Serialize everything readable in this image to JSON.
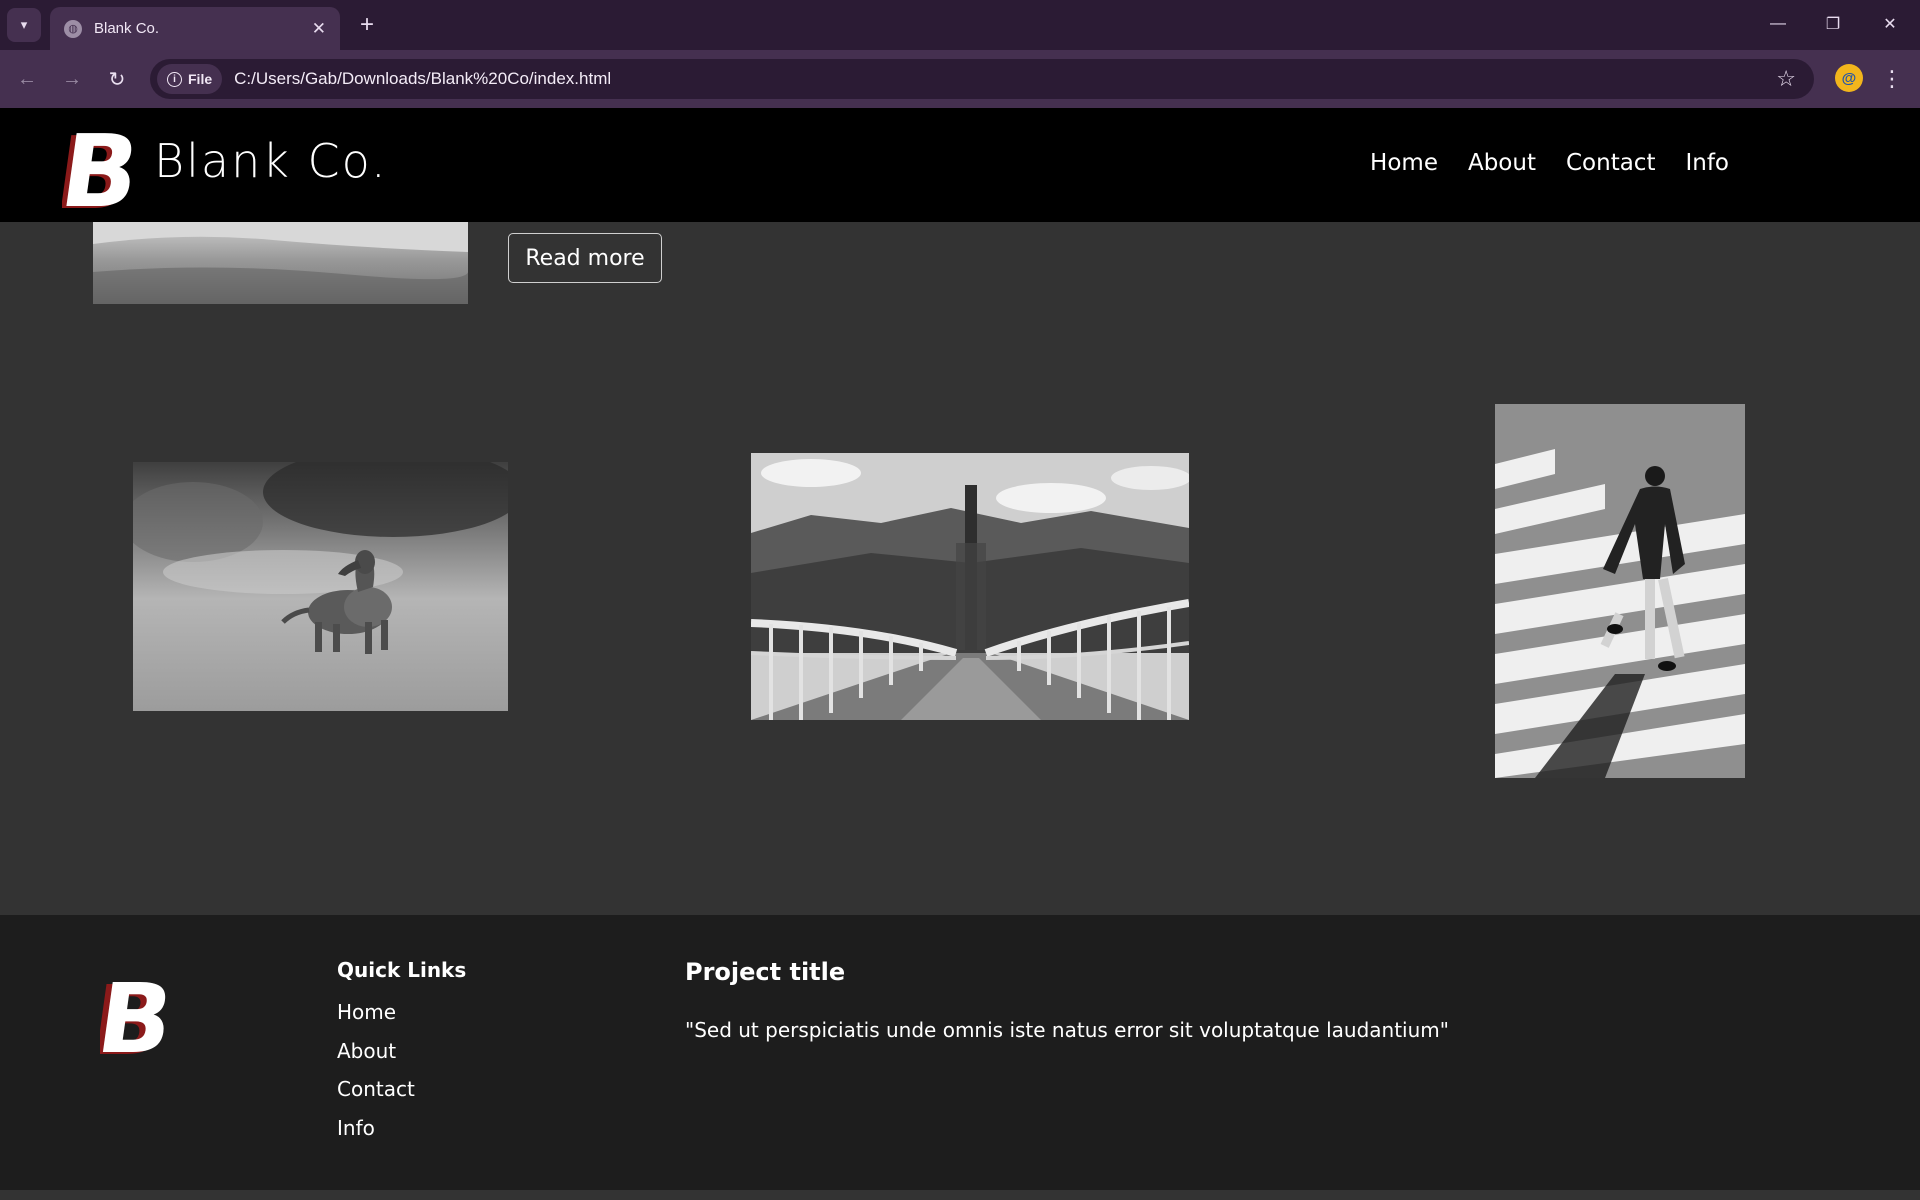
{
  "browser": {
    "tab_title": "Blank Co.",
    "new_tab": "+",
    "omnibox_chip": "File",
    "url": "C:/Users/Gab/Downloads/Blank%20Co/index.html",
    "icons": [
      "tab-search-icon",
      "globe-icon",
      "close-icon",
      "back-icon",
      "forward-icon",
      "reload-icon",
      "info-icon",
      "star-icon",
      "extension-icon",
      "menu-icon",
      "minimize-icon",
      "restore-icon",
      "window-close-icon"
    ]
  },
  "header": {
    "logo_letter": "B",
    "brand": "Blank Co.",
    "nav": [
      "Home",
      "About",
      "Contact",
      "Info"
    ]
  },
  "main": {
    "read_more": "Read more",
    "photos": [
      "clouds-photo",
      "dog-photo",
      "bridge-photo",
      "walking-man-photo"
    ]
  },
  "footer": {
    "logo_letter": "B",
    "quick_links_title": "Quick Links",
    "quick_links": [
      "Home",
      "About",
      "Contact",
      "Info"
    ],
    "project_title": "Project title",
    "project_text": "\"Sed ut perspiciatis unde omnis iste natus error sit voluptatque laudantium\""
  },
  "colors": {
    "tabbar": "#2b1b34",
    "toolbar": "#453050",
    "page_bg": "#333333",
    "header_bg": "#000000",
    "footer_bg": "#1d1d1d",
    "logo_shadow": "#8b1a1a"
  }
}
